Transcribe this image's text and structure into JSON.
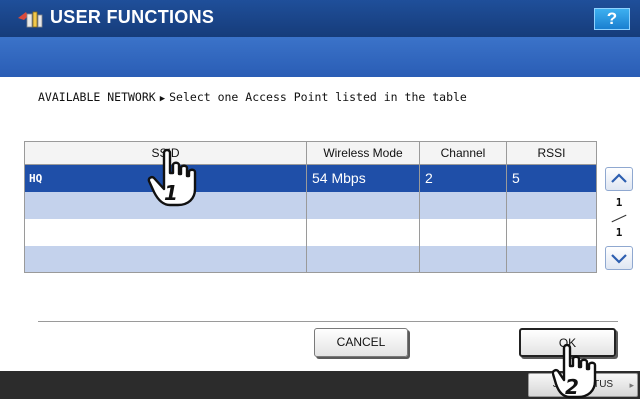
{
  "header": {
    "title": "USER FUNCTIONS",
    "help_label": "?"
  },
  "instruction": {
    "section": "AVAILABLE NETWORK",
    "text": "Select one Access Point listed in the table"
  },
  "table": {
    "columns": [
      "SSID",
      "Wireless Mode",
      "Channel",
      "RSSI"
    ],
    "rows": [
      {
        "ssid": "HQ",
        "mode": "54 Mbps",
        "channel": "2",
        "rssi": "5"
      },
      {
        "ssid": "",
        "mode": "",
        "channel": "",
        "rssi": ""
      },
      {
        "ssid": "",
        "mode": "",
        "channel": "",
        "rssi": ""
      },
      {
        "ssid": "",
        "mode": "",
        "channel": "",
        "rssi": ""
      }
    ]
  },
  "pagination": {
    "current": "1",
    "total": "1"
  },
  "buttons": {
    "cancel": "CANCEL",
    "ok": "OK"
  },
  "footer": {
    "job_status": "JOB STATUS"
  },
  "callouts": {
    "step1": "1",
    "step2": "2"
  },
  "icons": {
    "help": "question-icon",
    "scroll_up": "chevron-up-icon",
    "scroll_down": "chevron-down-icon",
    "title": "user-functions-icon"
  },
  "colors": {
    "title_bar": "#1f4f9a",
    "selected_row": "#1f4fa8",
    "alt_row": "#c4d2ec"
  }
}
